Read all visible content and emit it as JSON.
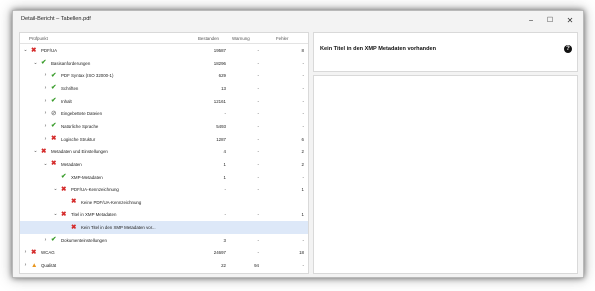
{
  "window": {
    "title": "Detail-Bericht – Tabellen.pdf",
    "controls": {
      "minimize": "−",
      "maximize": "☐",
      "close": "✕"
    }
  },
  "tree": {
    "columns": [
      "Prüfpunkt",
      "Bestanden",
      "Warnung",
      "Fehler"
    ],
    "rows": [
      {
        "chev": "⌄",
        "status": "fail",
        "icon": "✖",
        "label": "PDF/UA",
        "passed": "19587",
        "warnings": "-",
        "errors": "8"
      },
      {
        "chev": "⌄",
        "status": "pass",
        "icon": "✔",
        "label": "Basisanforderungen",
        "passed": "18296",
        "warnings": "-",
        "errors": "-"
      },
      {
        "chev": "›",
        "status": "pass",
        "icon": "✔",
        "label": "PDF Syntax (ISO 32000-1)",
        "passed": "629",
        "warnings": "-",
        "errors": "-"
      },
      {
        "chev": "›",
        "status": "pass",
        "icon": "✔",
        "label": "Schriften",
        "passed": "13",
        "warnings": "-",
        "errors": "-"
      },
      {
        "chev": "›",
        "status": "pass",
        "icon": "✔",
        "label": "Inhalt",
        "passed": "12161",
        "warnings": "-",
        "errors": "-"
      },
      {
        "chev": "›",
        "status": "skip",
        "icon": "⊘",
        "label": "Eingebettete Dateien",
        "passed": "-",
        "warnings": "-",
        "errors": "-"
      },
      {
        "chev": "›",
        "status": "pass",
        "icon": "✔",
        "label": "Natürliche Sprache",
        "passed": "5493",
        "warnings": "-",
        "errors": "-"
      },
      {
        "chev": "›",
        "status": "fail",
        "icon": "✖",
        "label": "Logische Struktur",
        "passed": "1287",
        "warnings": "-",
        "errors": "6"
      },
      {
        "chev": "⌄",
        "status": "fail",
        "icon": "✖",
        "label": "Metadaten und Einstellungen",
        "passed": "4",
        "warnings": "-",
        "errors": "2"
      },
      {
        "chev": "⌄",
        "status": "fail",
        "icon": "✖",
        "label": "Metadaten",
        "passed": "1",
        "warnings": "-",
        "errors": "2"
      },
      {
        "chev": "",
        "status": "pass",
        "icon": "✔",
        "label": "XMP-Metadaten",
        "passed": "1",
        "warnings": "-",
        "errors": "-"
      },
      {
        "chev": "⌄",
        "status": "fail",
        "icon": "✖",
        "label": "PDF/UA-Kennzeichnung",
        "passed": "-",
        "warnings": "-",
        "errors": "1"
      },
      {
        "chev": "",
        "status": "fail",
        "icon": "✖",
        "label": "Keine PDF/UA-Kennzeichnung",
        "passed": "",
        "warnings": "",
        "errors": ""
      },
      {
        "chev": "⌄",
        "status": "fail",
        "icon": "✖",
        "label": "Titel in XMP Metadaten",
        "passed": "-",
        "warnings": "-",
        "errors": "1"
      },
      {
        "chev": "",
        "status": "fail",
        "icon": "✖",
        "label": "Kein Titel in den XMP Metadaten vor...",
        "passed": "",
        "warnings": "",
        "errors": ""
      },
      {
        "chev": "›",
        "status": "pass",
        "icon": "✔",
        "label": "Dokumenteinstellungen",
        "passed": "3",
        "warnings": "-",
        "errors": "-"
      },
      {
        "chev": "›",
        "status": "fail",
        "icon": "✖",
        "label": "WCAG",
        "passed": "24697",
        "warnings": "-",
        "errors": "18"
      },
      {
        "chev": "›",
        "status": "warn",
        "icon": "▲",
        "label": "Qualität",
        "passed": "22",
        "warnings": "94",
        "errors": "-"
      }
    ]
  },
  "detail": {
    "title": "Kein Titel in den XMP Metadaten vorhanden",
    "help_icon": "?"
  }
}
